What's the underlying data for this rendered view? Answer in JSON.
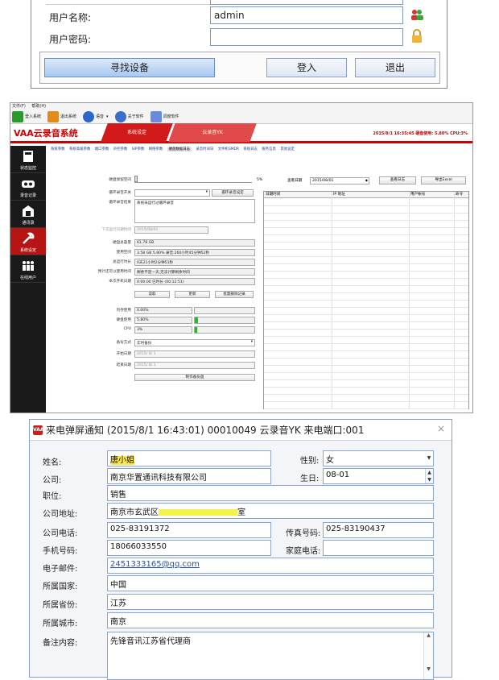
{
  "login": {
    "username_label": "用户名称:",
    "username_value": "admin",
    "password_label": "用户密码:",
    "password_value": "",
    "find_device_label": "寻找设备",
    "login_label": "登入",
    "exit_label": "退出"
  },
  "app": {
    "menu": [
      "文件(F)",
      "帮助(H)"
    ],
    "toolbar": [
      "登入系统",
      "退出系统",
      "语音",
      "关于软件",
      "调度软件"
    ],
    "brand": "VAA云录音系统",
    "tab_main": "系统设定",
    "tab_sub": "云录音YK",
    "status": "2015/8/1 16:35:45  硬盘使用: 5.80% CPU:3%",
    "sidebar": [
      "状态监控",
      "录音记录",
      "通讯录",
      "系统设定",
      "在线用户"
    ],
    "subtabs": [
      "系统参数",
      "系统高级参数",
      "端口参数",
      "声控参数",
      "SIP参数",
      "网络参数",
      "硬盘数据日志",
      "录音时间日",
      "文件机SMDR",
      "系统日志",
      "服务信息",
      "其他设定"
    ],
    "active_subtab": "硬盘数据日志",
    "disk_threshold_label": "硬盘保留空间",
    "disk_threshold_pct": "5%",
    "view_date_label": "查看日期",
    "view_date_value": "2015/08/01",
    "view_log_btn": "查看日志",
    "export_btn": "导出Excel",
    "loop_switch_label": "循环录音开关",
    "loop_setting_btn": "循环录音设定",
    "loop_result_label": "循环录音结果",
    "loop_result_value": "系统未运行过循环录音",
    "next_run_label": "下次运行日期时间",
    "next_run_value": "2015/08/01",
    "disk_total_label": "硬盘总容量",
    "disk_total_value": "61.78 GB",
    "used_label": "使用空间",
    "used_value": "3.58 GB 5.80% 录音:260小时45分钟52秒",
    "total_run_label": "总运行时长",
    "total_run_value": "0天21小时2分钟51秒",
    "remain_label": "预计还可以使用时间",
    "remain_value": "剩余不足一天,无法计算剩余时间",
    "boot_label": "本次开机日期",
    "boot_value": "0:00:00 已时长 (00:12:51)",
    "read_btn": "读取",
    "refresh_btn": "更新",
    "batch_del_btn": "批量删除记录",
    "mem_label": "内存使用",
    "mem_value": "0.00%",
    "disk_use_label": "硬盘使用",
    "disk_use_value": "5.80%",
    "cpu_label": "CPU",
    "cpu_value": "3%",
    "backup_mode_label": "备份方式",
    "backup_mode_value": "实时备份",
    "start_date_label": "开始日期",
    "start_date_value": "2015/ 8/ 1",
    "end_date_label": "结束日期",
    "end_date_value": "2015/ 8/ 1",
    "backup_btn": "制作备份盘",
    "grid_headers": [
      "日期时间",
      "IP 地址",
      "用户帐号",
      "命令"
    ],
    "disk_use_fraction": 0.058,
    "cpu_fraction": 0.03
  },
  "popup": {
    "title": "来电弹屏通知 (2015/8/1 16:43:01) 00010049 云录音YK 来电端口:001",
    "icon_text": "VAA",
    "name_label": "姓名:",
    "name_value": "唐小姐",
    "gender_label": "性别:",
    "gender_value": "女",
    "company_label": "公司:",
    "company_value": "南京华置通讯科技有限公司",
    "birthday_label": "生日:",
    "birthday_value": "08-01",
    "position_label": "职位:",
    "position_value": "销售",
    "address_label": "公司地址:",
    "address_value": "南京市玄武区",
    "address_tail": "室",
    "company_phone_label": "公司电话:",
    "company_phone_value": "025-83191372",
    "fax_label": "传真号码:",
    "fax_value": "025-83190437",
    "mobile_label": "手机号码:",
    "mobile_value": "18066033550",
    "home_phone_label": "家庭电话:",
    "home_phone_value": "",
    "email_label": "电子邮件:",
    "email_value": "2451333165@qq.com",
    "country_label": "所属国家:",
    "country_value": "中国",
    "province_label": "所属省份:",
    "province_value": "江苏",
    "city_label": "所属城市:",
    "city_value": "南京",
    "note_label": "备注内容:",
    "note_value": "先锋音讯江苏省代理商"
  }
}
